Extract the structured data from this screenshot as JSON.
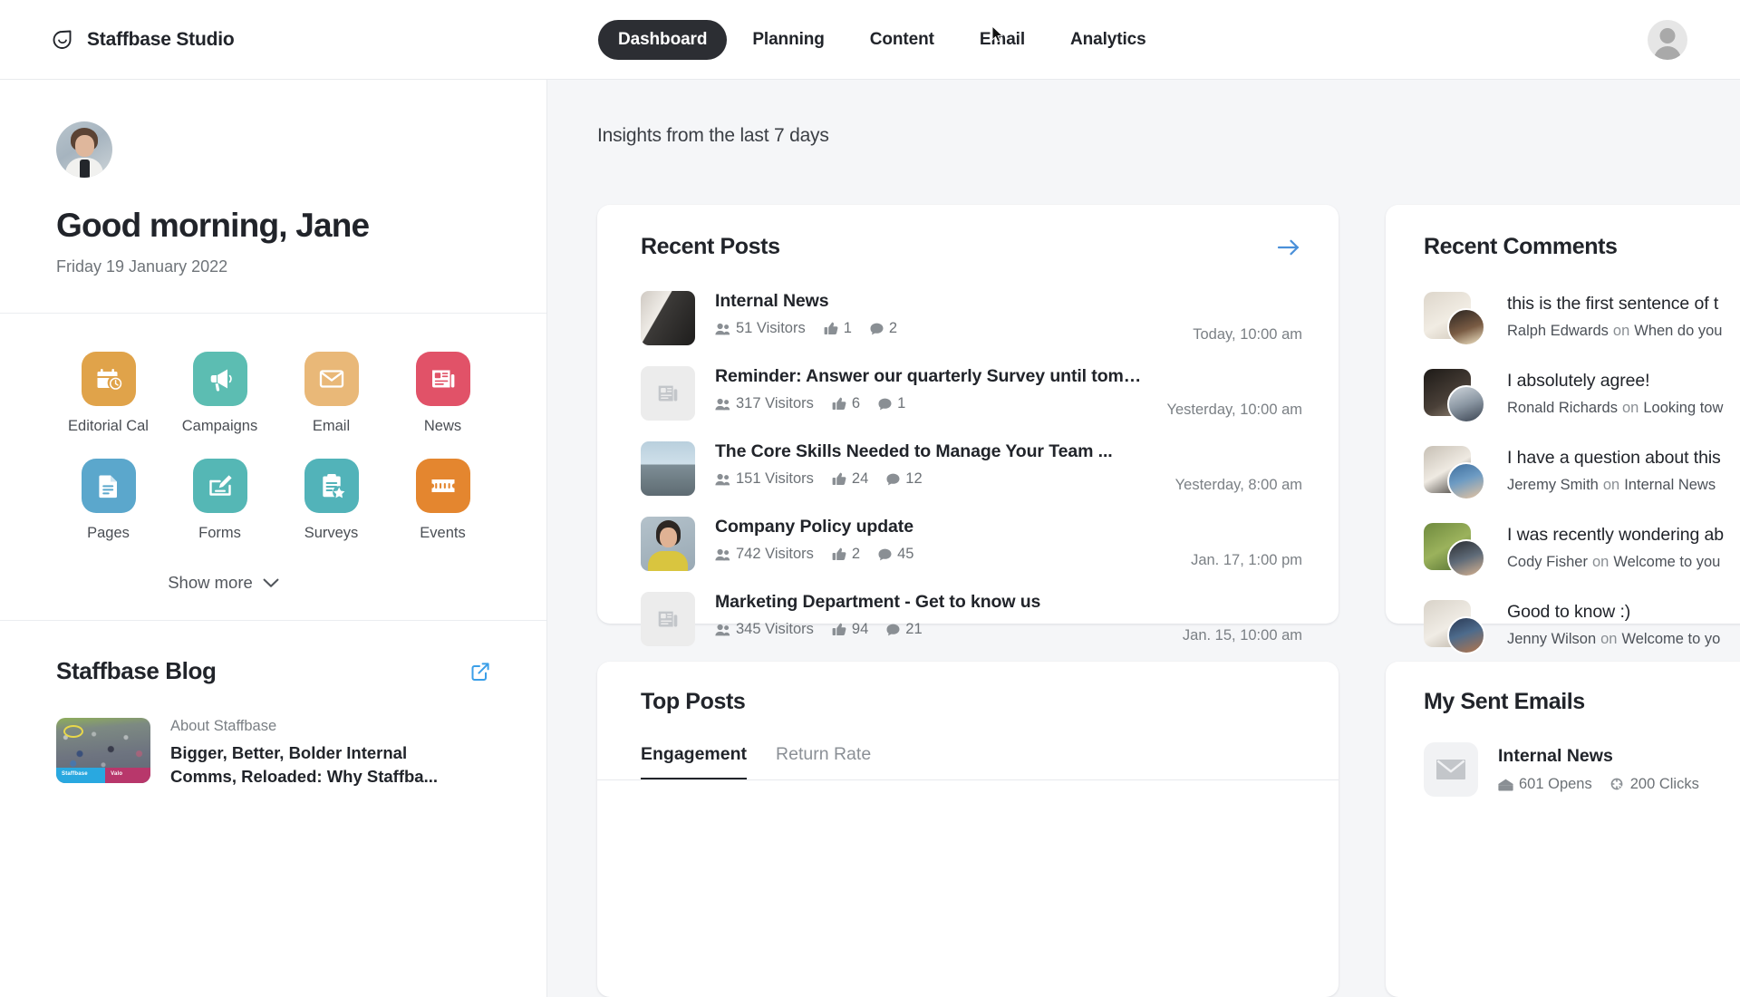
{
  "topbar": {
    "brand": "Staffbase Studio",
    "nav": [
      {
        "label": "Dashboard",
        "active": true
      },
      {
        "label": "Planning",
        "active": false
      },
      {
        "label": "Content",
        "active": false
      },
      {
        "label": "Email",
        "active": false
      },
      {
        "label": "Analytics",
        "active": false
      }
    ]
  },
  "sidebar": {
    "greeting": "Good morning, Jane",
    "date": "Friday 19 January 2022",
    "apps": [
      {
        "label": "Editorial Cal",
        "icon": "calendar-clock-icon",
        "color": "#e0a34a"
      },
      {
        "label": "Campaigns",
        "icon": "megaphone-icon",
        "color": "#5cbdb2"
      },
      {
        "label": "Email",
        "icon": "envelope-icon",
        "color": "#e9b878"
      },
      {
        "label": "News",
        "icon": "newspaper-icon",
        "color": "#e15268"
      },
      {
        "label": "Pages",
        "icon": "document-icon",
        "color": "#5ba7cc"
      },
      {
        "label": "Forms",
        "icon": "form-pen-icon",
        "color": "#55b7b5"
      },
      {
        "label": "Surveys",
        "icon": "clipboard-star-icon",
        "color": "#52b3b9"
      },
      {
        "label": "Events",
        "icon": "ticket-icon",
        "color": "#e4862f"
      }
    ],
    "show_more": "Show more",
    "blog": {
      "title": "Staffbase Blog",
      "kicker": "About Staffbase",
      "headline": "Bigger, Better, Bolder Internal Comms, Reloaded: Why Staffba..."
    }
  },
  "main": {
    "insights_label": "Insights from the last 7 days",
    "recent_posts": {
      "title": "Recent Posts",
      "items": [
        {
          "title": "Internal News",
          "visitors": "51 Visitors",
          "likes": "1",
          "comments": "2",
          "date": "Today, 10:00 am",
          "thumb": "office-photo"
        },
        {
          "title": "Reminder: Answer our quarterly Survey until tomorrow!",
          "visitors": "317 Visitors",
          "likes": "6",
          "comments": "1",
          "date": "Yesterday, 10:00 am",
          "thumb": "placeholder"
        },
        {
          "title": "The Core Skills Needed to Manage Your Team ...",
          "visitors": "151 Visitors",
          "likes": "24",
          "comments": "12",
          "date": "Yesterday, 8:00 am",
          "thumb": "mountain-photo"
        },
        {
          "title": "Company Policy update",
          "visitors": "742 Visitors",
          "likes": "2",
          "comments": "45",
          "date": "Jan. 17, 1:00 pm",
          "thumb": "person-photo"
        },
        {
          "title": "Marketing Department - Get to know us",
          "visitors": "345 Visitors",
          "likes": "94",
          "comments": "21",
          "date": "Jan. 15, 10:00 am",
          "thumb": "placeholder"
        }
      ]
    },
    "recent_comments": {
      "title": "Recent Comments",
      "items": [
        {
          "text": "this is the first sentence of t",
          "author": "Ralph Edwards",
          "on": "on",
          "post": "When do you"
        },
        {
          "text": "I absolutely agree!",
          "author": "Ronald Richards",
          "on": "on",
          "post": "Looking tow"
        },
        {
          "text": "I have a question about this",
          "author": "Jeremy Smith",
          "on": "on",
          "post": "Internal News"
        },
        {
          "text": "I was recently wondering ab",
          "author": "Cody Fisher",
          "on": "on",
          "post": "Welcome to you"
        },
        {
          "text": "Good to know :)",
          "author": "Jenny Wilson",
          "on": "on",
          "post": "Welcome to yo"
        }
      ]
    },
    "top_posts": {
      "title": "Top Posts",
      "tabs": [
        {
          "label": "Engagement",
          "active": true
        },
        {
          "label": "Return Rate",
          "active": false
        }
      ]
    },
    "sent_emails": {
      "title": "My Sent Emails",
      "items": [
        {
          "title": "Internal News",
          "opens": "601 Opens",
          "clicks": "200 Clicks"
        }
      ]
    }
  },
  "colors": {
    "accent_blue": "#4a90d9",
    "nav_active_bg": "#2c2e33",
    "page_bg": "#f5f6f8"
  }
}
